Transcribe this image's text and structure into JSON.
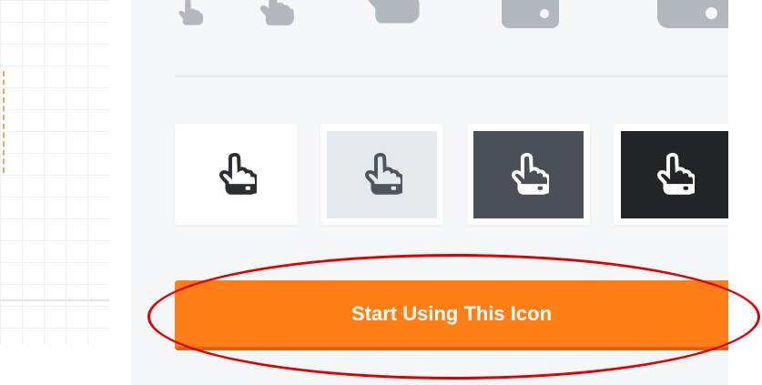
{
  "preview": {
    "icon_name": "hand-pointer-icon",
    "size_sample_color": "#b3b8be"
  },
  "swatches": [
    {
      "name": "white-background",
      "background": "#ffffff",
      "icon_color": "#2b2e33",
      "accent": "#ffffff"
    },
    {
      "name": "light-gray-background",
      "background": "#e6e9ec",
      "icon_color": "#50555c",
      "accent": "#e6e9ec"
    },
    {
      "name": "dark-gray-background",
      "background": "#4b5058",
      "icon_color": "#ffffff",
      "accent": "#4b5058"
    },
    {
      "name": "black-background",
      "background": "#222428",
      "icon_color": "#ffffff",
      "accent": "#222428"
    }
  ],
  "cta": {
    "label": "Start Using This Icon",
    "color": "#ff7f16"
  },
  "annotation": {
    "ring_color": "#e00000"
  }
}
